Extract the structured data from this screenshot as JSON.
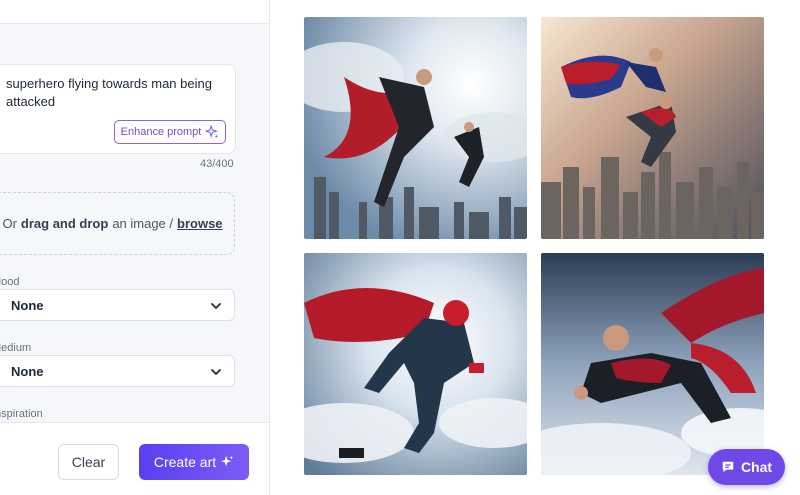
{
  "prompt": {
    "text": "superhero flying towards man being attacked",
    "enhance_label": "Enhance prompt",
    "char_count": "43/400"
  },
  "upload": {
    "prefix": "Or",
    "bold": "drag and drop",
    "middle": "an image /",
    "browse": "browse"
  },
  "fields": {
    "mood_label": "Mood",
    "mood_value": "None",
    "medium_label": "Medium",
    "medium_value": "None",
    "inspiration_label": "Inspiration"
  },
  "actions": {
    "clear_label": "Clear",
    "create_label": "Create art"
  },
  "gallery": {
    "count": 4,
    "images": [
      {
        "subject": "caped hero flying over city toward man"
      },
      {
        "subject": "two caped heroes above skyscrapers at sunset"
      },
      {
        "subject": "red masked hero leaping among clouds"
      },
      {
        "subject": "caped man flying through clouds"
      }
    ]
  },
  "chat": {
    "label": "Chat"
  },
  "colors": {
    "accent": "#6f49e8",
    "enhance_border": "#8b5cf6"
  }
}
